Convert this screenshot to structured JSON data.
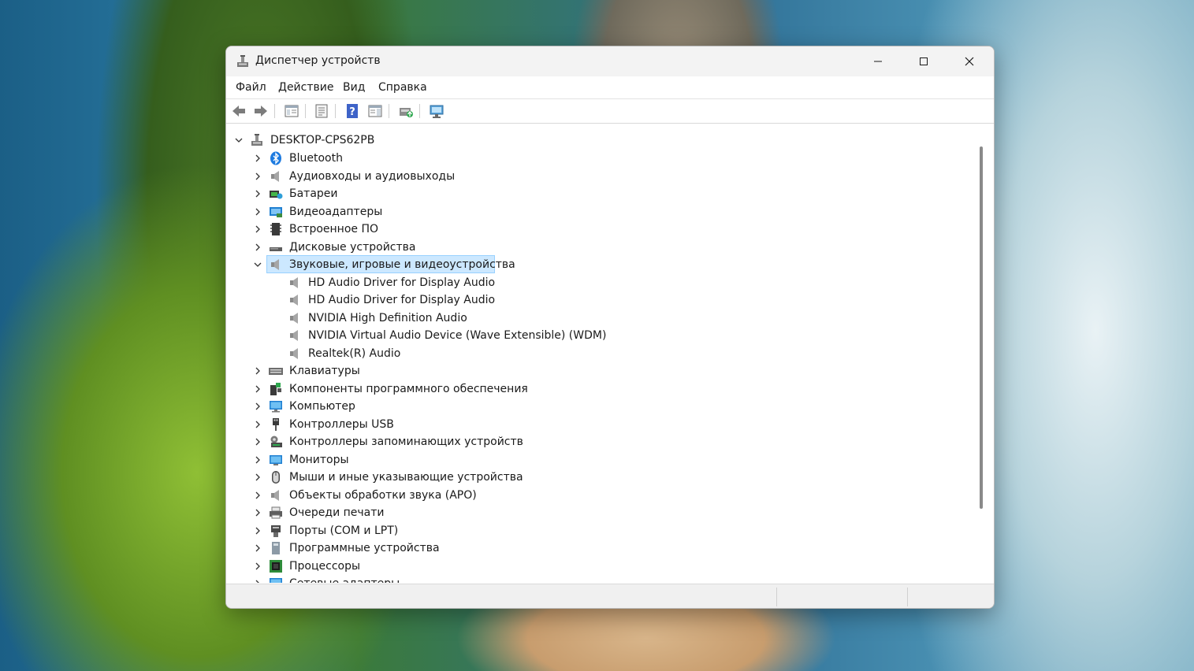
{
  "window": {
    "title": "Диспетчер устройств"
  },
  "menu": [
    "Файл",
    "Действие",
    "Вид",
    "Справка"
  ],
  "tree": {
    "root": "DESKTOP-CPS62PB",
    "categories": [
      {
        "label": "Bluetooth",
        "icon": "bluetooth-icon"
      },
      {
        "label": "Аудиовходы и аудиовыходы",
        "icon": "speaker-icon"
      },
      {
        "label": "Батареи",
        "icon": "battery-icon"
      },
      {
        "label": "Видеоадаптеры",
        "icon": "display-adapter-icon"
      },
      {
        "label": "Встроенное ПО",
        "icon": "firmware-icon"
      },
      {
        "label": "Дисковые устройства",
        "icon": "disk-drive-icon"
      },
      {
        "label": "Звуковые, игровые и видеоустройства",
        "icon": "speaker-icon",
        "expanded": true,
        "children": [
          "HD Audio Driver for Display Audio",
          "HD Audio Driver for Display Audio",
          "NVIDIA High Definition Audio",
          "NVIDIA Virtual Audio Device (Wave Extensible) (WDM)",
          "Realtek(R) Audio"
        ]
      },
      {
        "label": "Клавиатуры",
        "icon": "keyboard-icon"
      },
      {
        "label": "Компоненты программного обеспечения",
        "icon": "software-component-icon"
      },
      {
        "label": "Компьютер",
        "icon": "computer-icon"
      },
      {
        "label": "Контроллеры USB",
        "icon": "usb-icon"
      },
      {
        "label": "Контроллеры запоминающих устройств",
        "icon": "storage-controller-icon"
      },
      {
        "label": "Мониторы",
        "icon": "monitor-icon"
      },
      {
        "label": "Мыши и иные указывающие устройства",
        "icon": "mouse-icon"
      },
      {
        "label": "Объекты обработки звука (APO)",
        "icon": "speaker-icon"
      },
      {
        "label": "Очереди печати",
        "icon": "printer-icon"
      },
      {
        "label": "Порты (COM и LPT)",
        "icon": "port-icon"
      },
      {
        "label": "Программные устройства",
        "icon": "software-device-icon"
      },
      {
        "label": "Процессоры",
        "icon": "processor-icon"
      },
      {
        "label": "Сетевые адаптеры",
        "icon": "network-adapter-icon"
      }
    ]
  }
}
